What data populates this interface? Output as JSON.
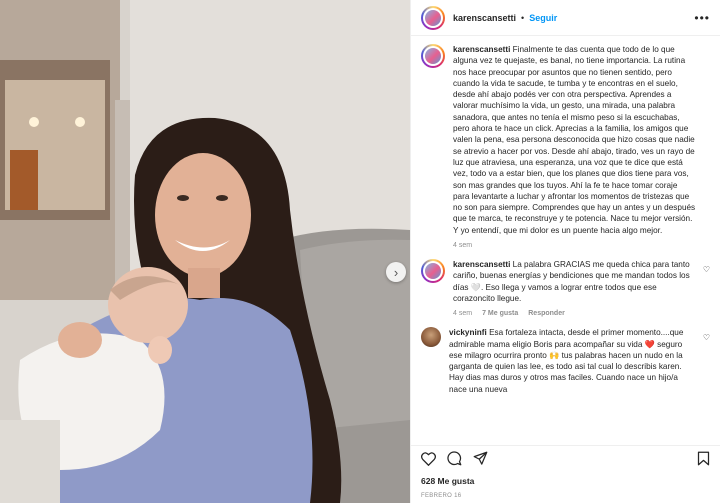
{
  "header": {
    "username": "karenscansetti",
    "separator": "•",
    "follow_label": "Seguir",
    "more_icon": "more-horizontal-icon"
  },
  "caption": {
    "username": "karenscansetti",
    "text": "Finalmente te das cuenta que todo de lo que alguna vez te quejaste, es banal, no tiene importancia. La rutina nos hace preocupar por asuntos que no tienen sentido, pero cuando la vida te sacude, te tumba y te encontras en el suelo, desde ahí abajo podés ver con otra perspectiva. Aprendes a valorar muchísimo la vida, un gesto, una mirada, una palabra sanadora, que antes no tenía el mismo peso si la escuchabas, pero ahora te hace un click. Aprecias a la familia, los amigos que valen la pena, esa persona desconocida que hizo cosas que nadie se atrevio a hacer por vos. Desde ahí abajo, tirado, ves un rayo de luz que atraviesa, una esperanza, una voz que te dice que está vez, todo va a estar bien, que los planes que dios tiene para vos, son mas grandes que los tuyos. Ahí la fe te hace tomar coraje para levantarte a luchar y afrontar los momentos de tristezas que no son para siempre. Comprendes que hay un antes y un después que te marca, te reconstruye y te potencia. Nace tu mejor versión. Y yo entendí, que mi dolor es un puente hacia algo mejor.",
    "time": "4 sem"
  },
  "comments": [
    {
      "username": "karenscansetti",
      "text": "La palabra GRACIAS me queda chica para tanto cariño, buenas energías y bendiciones que me mandan todos los días 🤍. Eso llega y vamos a lograr entre todos que ese corazoncito llegue.",
      "time": "4 sem",
      "likes": "7 Me gusta",
      "reply": "Responder"
    },
    {
      "username": "vickyninfi",
      "text": "Esa fortaleza intacta, desde el primer momento....que admirable mama eligio Boris para acompañar su vida ❤️ seguro ese milagro ocurrira pronto 🙌 tus palabras hacen un nudo en la garganta de quien las lee, es todo asi tal cual lo describis karen. Hay dias mas duros y otros mas faciles. Cuando nace un hijo/a nace una nueva"
    }
  ],
  "footer": {
    "likes": "628 Me gusta",
    "date": "FEBRERO 16"
  },
  "icons": {
    "like": "heart-icon",
    "comment": "comment-icon",
    "share": "share-icon",
    "save": "bookmark-icon",
    "next": "chevron-right-icon"
  },
  "colors": {
    "accent": "#0095f6",
    "meta": "#8e8e8e",
    "text": "#262626"
  }
}
